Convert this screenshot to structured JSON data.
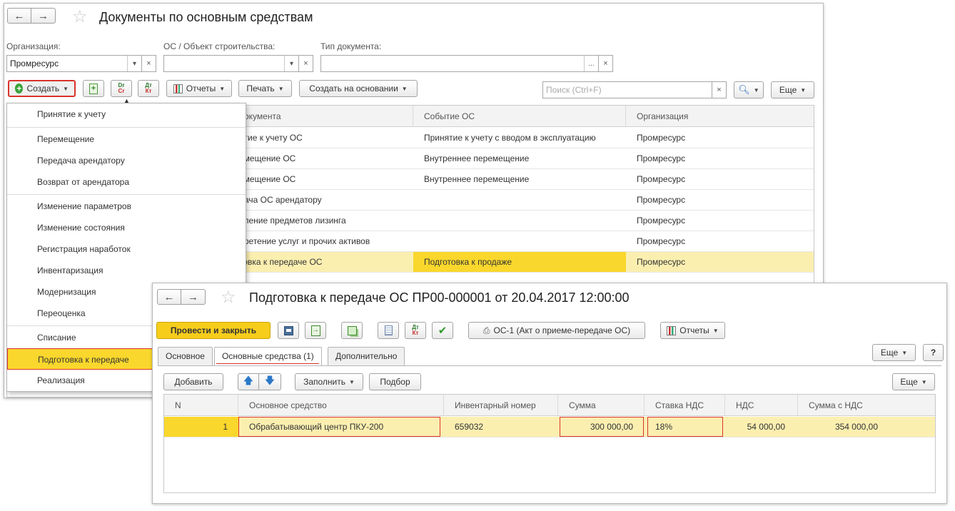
{
  "main_window": {
    "title": "Документы по основным средствам",
    "filters": {
      "org_label": "Организация:",
      "org_value": "Промресурс",
      "os_label": "ОС / Объект строительства:",
      "os_value": "",
      "doctype_label": "Тип документа:",
      "doctype_value": ""
    },
    "toolbar": {
      "create_label": "Создать",
      "reports_label": "Отчеты",
      "print_label": "Печать",
      "create_based_label": "Создать на основании",
      "search_placeholder": "Поиск (Ctrl+F)",
      "more_label": "Еще"
    },
    "table": {
      "columns": [
        "Вид документа",
        "Событие ОС",
        "Организация"
      ],
      "columns_visible": [
        "документа",
        "Событие ОС",
        "Организация"
      ],
      "rows": [
        {
          "doc": "ятие к учету ОС",
          "event": "Принятие к учету с вводом в эксплуатацию",
          "org": "Промресурс"
        },
        {
          "doc": "емещение ОС",
          "event": "Внутреннее перемещение",
          "org": "Промресурс"
        },
        {
          "doc": "емещение ОС",
          "event": "Внутреннее перемещение",
          "org": "Промресурс"
        },
        {
          "doc": "дача ОС арендатору",
          "event": "",
          "org": "Промресурс"
        },
        {
          "doc": "пление предметов лизинга",
          "event": "",
          "org": "Промресурс"
        },
        {
          "doc": "бретение услуг и прочих активов",
          "event": "",
          "org": "Промресурс"
        },
        {
          "doc": "товка к передаче ОС",
          "event": "Подготовка к продаже",
          "org": "Промресурс"
        }
      ]
    },
    "create_menu": {
      "items": [
        "Принятие к учету",
        "Перемещение",
        "Передача арендатору",
        "Возврат от арендатора",
        "Изменение параметров",
        "Изменение состояния",
        "Регистрация наработок",
        "Инвентаризация",
        "Модернизация",
        "Переоценка",
        "Списание",
        "Подготовка к передаче",
        "Реализация"
      ]
    }
  },
  "doc_window": {
    "title": "Подготовка к передаче ОС ПР00-000001 от 20.04.2017 12:00:00",
    "toolbar": {
      "post_close_label": "Провести и закрыть",
      "print_form_label": "ОС-1 (Акт о приеме-передаче ОС)",
      "reports_label": "Отчеты",
      "more_label": "Еще",
      "help_label": "?"
    },
    "tabs": [
      "Основное",
      "Основные средства (1)",
      "Дополнительно"
    ],
    "grid_toolbar": {
      "add_label": "Добавить",
      "fill_label": "Заполнить",
      "pick_label": "Подбор",
      "more_label": "Еще"
    },
    "table": {
      "columns": [
        "N",
        "Основное средство",
        "Инвентарный номер",
        "Сумма",
        "Ставка НДС",
        "НДС",
        "Сумма с НДС"
      ],
      "rows": [
        {
          "n": "1",
          "asset": "Обрабатывающий центр ПКУ-200",
          "inv": "659032",
          "sum": "300 000,00",
          "vat_rate": "18%",
          "vat": "54 000,00",
          "sum_vat": "354 000,00"
        }
      ]
    }
  },
  "colors": {
    "highlight_row": "#fbefb0",
    "selected_cell": "#f9d72c",
    "accent_red": "#d9332b",
    "post_button": "#f7cd1c"
  },
  "icons": [
    "back-arrow-icon",
    "forward-arrow-icon",
    "favorite-star-icon",
    "plus-circle-icon",
    "dr-cr-icon",
    "dt-kt-icon",
    "chart-icon",
    "search-icon",
    "save-icon",
    "printer-icon",
    "check-icon",
    "arrow-up-icon",
    "arrow-down-icon"
  ]
}
